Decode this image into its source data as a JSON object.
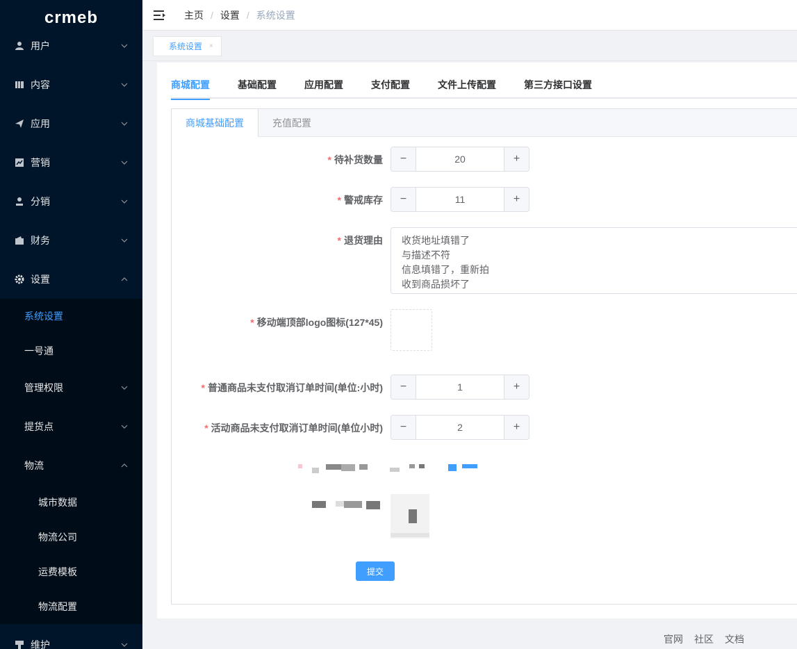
{
  "sidebar": {
    "logo": "crmeb",
    "items": [
      {
        "label": "用户",
        "icon": "user-icon"
      },
      {
        "label": "内容",
        "icon": "content-icon"
      },
      {
        "label": "应用",
        "icon": "send-icon"
      },
      {
        "label": "营销",
        "icon": "chart-icon"
      },
      {
        "label": "分销",
        "icon": "distribution-icon"
      },
      {
        "label": "财务",
        "icon": "wallet-icon"
      },
      {
        "label": "设置",
        "icon": "gear-icon"
      }
    ],
    "settings_sub": [
      {
        "label": "系统设置",
        "active": true
      },
      {
        "label": "一号通"
      },
      {
        "label": "管理权限"
      },
      {
        "label": "提货点"
      },
      {
        "label": "物流"
      }
    ],
    "logistics_sub": [
      {
        "label": "城市数据"
      },
      {
        "label": "物流公司"
      },
      {
        "label": "运费模板"
      },
      {
        "label": "物流配置"
      }
    ],
    "last_item": {
      "label": "维护",
      "icon": "maintain-icon"
    }
  },
  "header": {
    "breadcrumb": [
      "主页",
      "设置",
      "系统设置"
    ]
  },
  "tagsbar": {
    "tag_label": "系统设置",
    "tag_close": "×"
  },
  "tabs": [
    "商城配置",
    "基础配置",
    "应用配置",
    "支付配置",
    "文件上传配置",
    "第三方接口设置"
  ],
  "inner_tabs": [
    "商城基础配置",
    "充值配置"
  ],
  "form": {
    "restock": {
      "label": "待补货数量",
      "value": "20"
    },
    "warn_stock": {
      "label": "警戒库存",
      "value": "11"
    },
    "return_reason": {
      "label": "退货理由",
      "lines": [
        "收货地址填错了",
        "与描述不符",
        "信息填错了，重新拍",
        "收到商品损坏了"
      ]
    },
    "mobile_logo": {
      "label": "移动端顶部logo图标(127*45)"
    },
    "normal_cancel": {
      "label": "普通商品未支付取消订单时间(单位:小时)",
      "value": "1"
    },
    "activity_cancel": {
      "label": "活动商品未支付取消订单时间(单位小时)",
      "value": "2"
    },
    "required_mark": "*",
    "minus": "−",
    "plus": "+",
    "submit_label": "提交"
  },
  "footer": [
    "官网",
    "社区",
    "文档"
  ],
  "colors": {
    "sidebar_bg": "#001529",
    "accent": "#409eff",
    "required": "#f56c6c"
  }
}
